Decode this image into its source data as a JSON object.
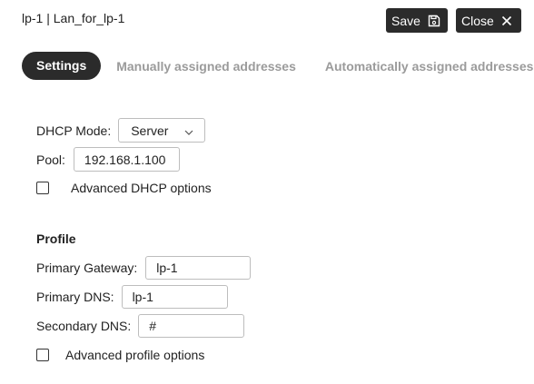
{
  "header": {
    "title": "lp-1 | Lan_for_lp-1",
    "save_label": "Save",
    "close_label": "Close"
  },
  "tabs": [
    {
      "label": "Settings",
      "active": true
    },
    {
      "label": "Manually assigned addresses",
      "active": false
    },
    {
      "label": "Automatically assigned addresses",
      "active": false
    }
  ],
  "dhcp": {
    "mode_label": "DHCP Mode:",
    "mode_value": "Server",
    "pool_label": "Pool:",
    "pool_value": "192.168.1.100",
    "advanced_label": "Advanced DHCP options",
    "advanced_checked": false
  },
  "profile": {
    "title": "Profile",
    "primary_gateway_label": "Primary Gateway:",
    "primary_gateway_value": "lp-1",
    "primary_dns_label": "Primary DNS:",
    "primary_dns_value": "lp-1",
    "secondary_dns_label": "Secondary DNS:",
    "secondary_dns_value": "#",
    "advanced_label": "Advanced profile options",
    "advanced_checked": false
  },
  "colors": {
    "dark": "#2b2b2b",
    "tab_inactive": "#9b9b9b",
    "border": "#bdbdbd"
  },
  "icons": [
    "save-icon",
    "close-icon",
    "chevron-down-icon"
  ]
}
